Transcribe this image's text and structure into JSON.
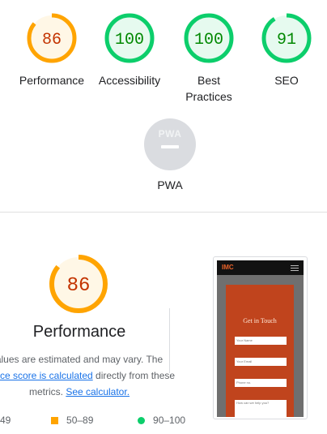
{
  "gauges": [
    {
      "label": "Performance",
      "score": "86",
      "value": 0.86,
      "color": "#ffa400",
      "fill": "#fff7e6",
      "text": "#c33300"
    },
    {
      "label": "Accessibility",
      "score": "100",
      "value": 1.0,
      "color": "#0cce6b",
      "fill": "#e6faef",
      "text": "#008800"
    },
    {
      "label": "Best\nPractices",
      "score": "100",
      "value": 1.0,
      "color": "#0cce6b",
      "fill": "#e6faef",
      "text": "#008800"
    },
    {
      "label": "SEO",
      "score": "91",
      "value": 0.91,
      "color": "#0cce6b",
      "fill": "#e6faef",
      "text": "#008800"
    }
  ],
  "pwa": {
    "label": "PWA",
    "badge_text": "PWA",
    "icon": "pwa-badge-icon"
  },
  "performance": {
    "score": "86",
    "value": 0.86,
    "title": "Performance",
    "desc_1": "alues are estimated and may vary. The",
    "desc_link_1": "nance score is calculated",
    "desc_2": " directly from these",
    "desc_3": "metrics. ",
    "desc_link_2": "See calculator."
  },
  "legend": {
    "fail": "49",
    "average": "50–89",
    "pass": "90–100"
  },
  "screenshot": {
    "logo": "IMC",
    "form_title": "Get in Touch",
    "fields": [
      "Your Name",
      "Your Email",
      "Phone no.",
      "How can we help you?"
    ]
  }
}
